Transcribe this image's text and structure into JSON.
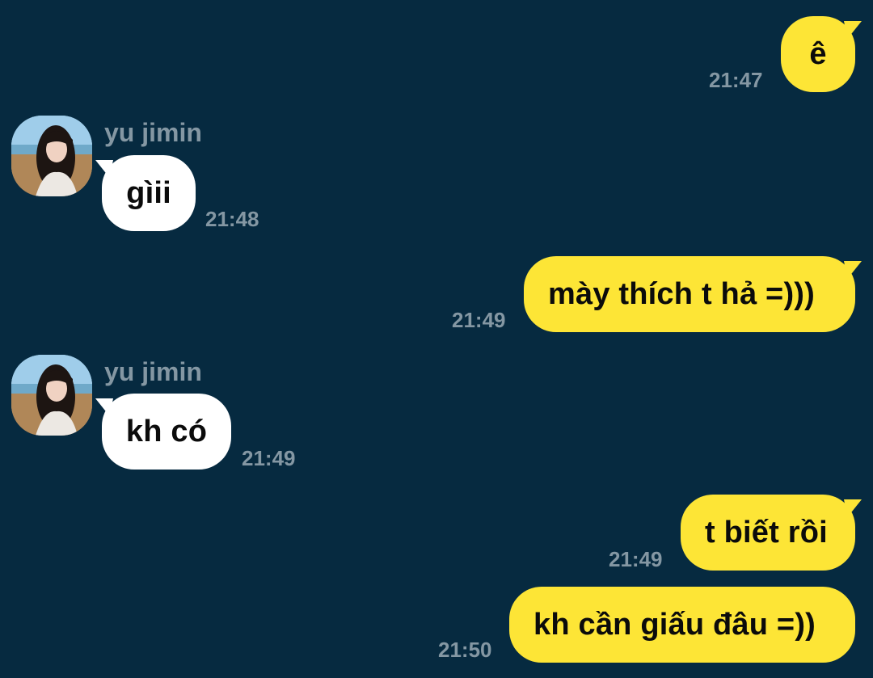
{
  "messages": [
    {
      "side": "out",
      "text": "ê",
      "time": "21:47"
    },
    {
      "side": "in",
      "sender": "yu jimin",
      "text": "gìii",
      "time": "21:48"
    },
    {
      "side": "out",
      "text": "mày thích t hả =)))",
      "time": "21:49"
    },
    {
      "side": "in",
      "sender": "yu jimin",
      "text": "kh có",
      "time": "21:49"
    },
    {
      "side": "out",
      "text": "t biết rồi",
      "time": "21:49"
    },
    {
      "side": "out",
      "text": "kh cần giấu đâu =))",
      "time": "21:50"
    }
  ],
  "colors": {
    "background": "#062a40",
    "outgoing_bubble": "#fde536",
    "incoming_bubble": "#ffffff",
    "meta_text": "#8497a3"
  },
  "icons": {
    "avatar": "profile-photo"
  }
}
